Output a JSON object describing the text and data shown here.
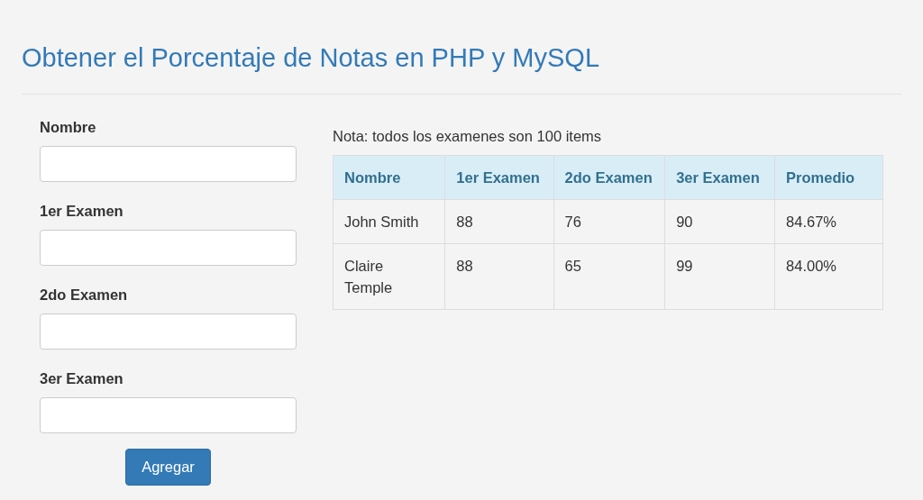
{
  "title": "Obtener el Porcentaje de Notas en PHP y MySQL",
  "form": {
    "fields": [
      {
        "label": "Nombre"
      },
      {
        "label": "1er Examen"
      },
      {
        "label": "2do Examen"
      },
      {
        "label": "3er Examen"
      }
    ],
    "button": "Agregar"
  },
  "note": "Nota: todos los examenes son 100 items",
  "table": {
    "columns": [
      "Nombre",
      "1er Examen",
      "2do Examen",
      "3er Examen",
      "Promedio"
    ],
    "rows": [
      [
        "John Smith",
        "88",
        "76",
        "90",
        "84.67%"
      ],
      [
        "Claire Temple",
        "88",
        "65",
        "99",
        "84.00%"
      ]
    ]
  }
}
